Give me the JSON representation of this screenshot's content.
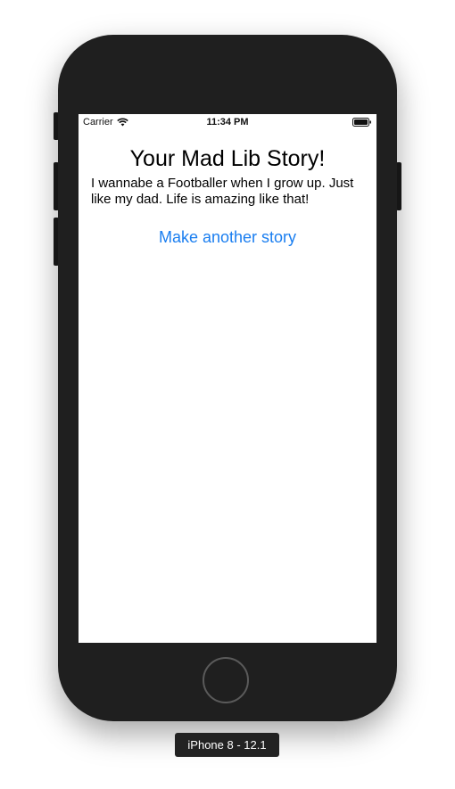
{
  "device": {
    "label": "iPhone 8 - 12.1"
  },
  "status_bar": {
    "carrier": "Carrier",
    "time": "11:34 PM",
    "icons": [
      "wifi-icon",
      "battery-icon"
    ]
  },
  "screen": {
    "title": "Your Mad Lib Story!",
    "story": "I wannabe a Footballer when I grow up. Just like my dad. Life is amazing like that!",
    "action_button": "Make another story"
  },
  "colors": {
    "accent": "#1a7ef0",
    "phone_body": "#1f1f1f",
    "screen_bg": "#ffffff"
  }
}
